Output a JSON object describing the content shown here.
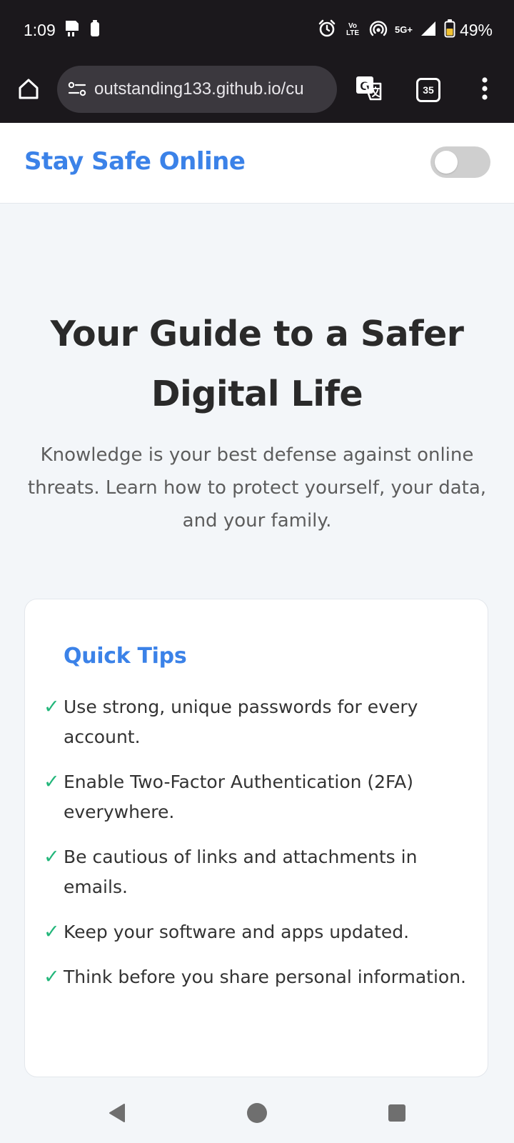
{
  "status_bar": {
    "time": "1:09",
    "battery_percent": "49%",
    "network": "5G+",
    "volte_label_top": "Vo",
    "volte_label_bottom": "LTE",
    "icons": [
      "sim-card-icon",
      "battery-saver-icon",
      "alarm-icon",
      "volte-icon",
      "hotspot-icon",
      "5g-icon",
      "signal-icon",
      "battery-icon"
    ]
  },
  "browser": {
    "url": "outstanding133.github.io/cu",
    "tab_count": "35",
    "icons": [
      "home-icon",
      "site-info-icon",
      "translate-icon",
      "tabs-icon",
      "more-menu-icon"
    ]
  },
  "header": {
    "logo": "Stay Safe Online"
  },
  "hero": {
    "title": "Your Guide to a Safer Digital Life",
    "subtitle": "Knowledge is your best defense against online threats. Learn how to protect yourself, your data, and your family."
  },
  "quick_tips": {
    "title": "Quick Tips",
    "check_glyph": "✓",
    "items": [
      "Use strong, unique passwords for every account.",
      "Enable Two-Factor Authentication (2FA) everywhere.",
      "Be cautious of links and attachments in emails.",
      "Keep your software and apps updated.",
      "Think before you share personal information."
    ]
  },
  "colors": {
    "accent": "#3b82e8",
    "check": "#22b67a",
    "status_bar_bg": "#1b181c",
    "page_bg": "#f3f6f9"
  }
}
